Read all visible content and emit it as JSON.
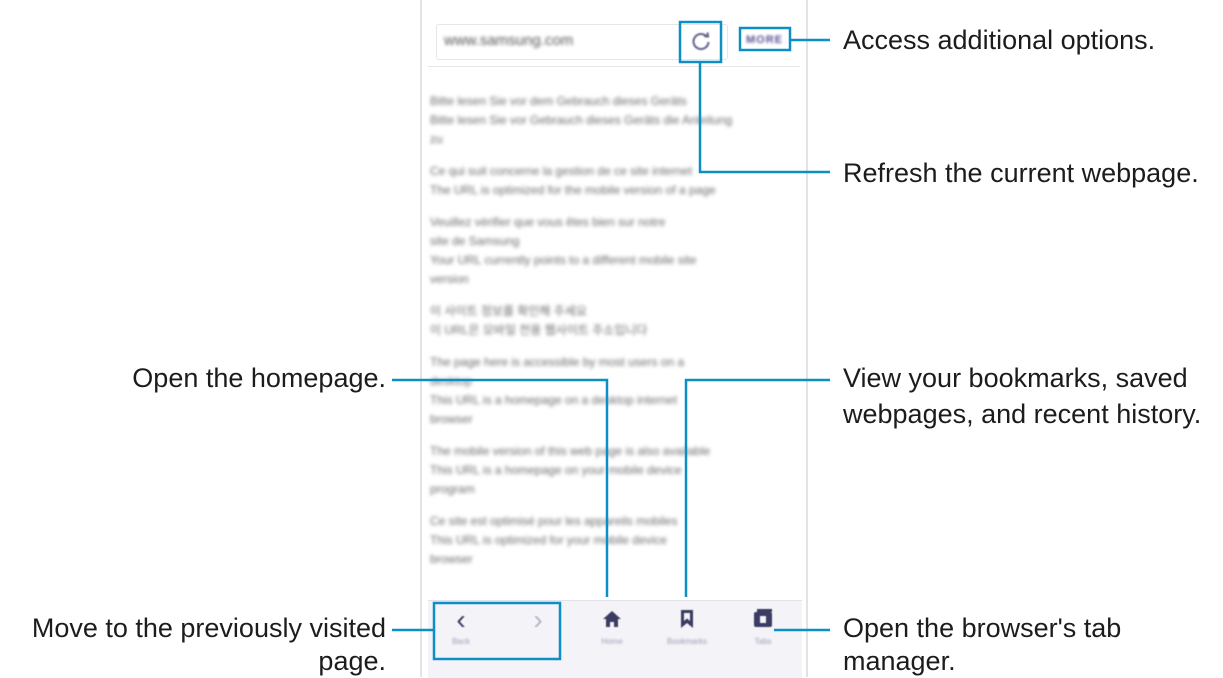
{
  "browser": {
    "url": "www.samsung.com",
    "more_label": "MORE",
    "content_lines": [
      [
        "Bitte lesen Sie vor dem Gebrauch dieses Geräts",
        "Bitte lesen Sie vor Gebrauch dieses Geräts die Anleitung",
        "zu"
      ],
      [
        "Ce qui suit concerne la gestion de ce site internet",
        "The URL is optimized for the mobile version of a page"
      ],
      [
        "Veuillez vérifier que vous êtes bien sur notre",
        "site de Samsung",
        "Your URL currently points to a different mobile site",
        "version"
      ],
      [
        "이 사이트 정보를 확인해 주세요",
        "이 URL은 모바일 전용 웹사이트 주소입니다"
      ],
      [
        "The page here is accessible by most users on a",
        "desktop",
        "This URL is a homepage on a desktop internet",
        "browser"
      ],
      [
        "The mobile version of this web page is also available",
        "This URL is a homepage on your mobile device",
        "program"
      ],
      [
        "Ce site est optimisé pour les appareils mobiles",
        "This URL is optimized for your mobile device",
        "browser"
      ]
    ],
    "nav": {
      "back_label": "Back",
      "forward_label": "",
      "home_label": "Home",
      "bookmarks_label": "Bookmarks",
      "tabs_label": "Tabs"
    }
  },
  "callouts": {
    "more": "Access additional options.",
    "refresh": "Refresh the current webpage.",
    "home": "Open the homepage.",
    "bookmarks_line1": "View your bookmarks, saved",
    "bookmarks_line2": "webpages, and recent history.",
    "back_line1": "Move to the previously visited",
    "back_line2": "page.",
    "tabs_line1": "Open the browser's tab",
    "tabs_line2": "manager."
  },
  "colors": {
    "callout_line": "#0d8fc6",
    "text": "#1c1c1c",
    "nav_icon": "#3b3b63"
  }
}
